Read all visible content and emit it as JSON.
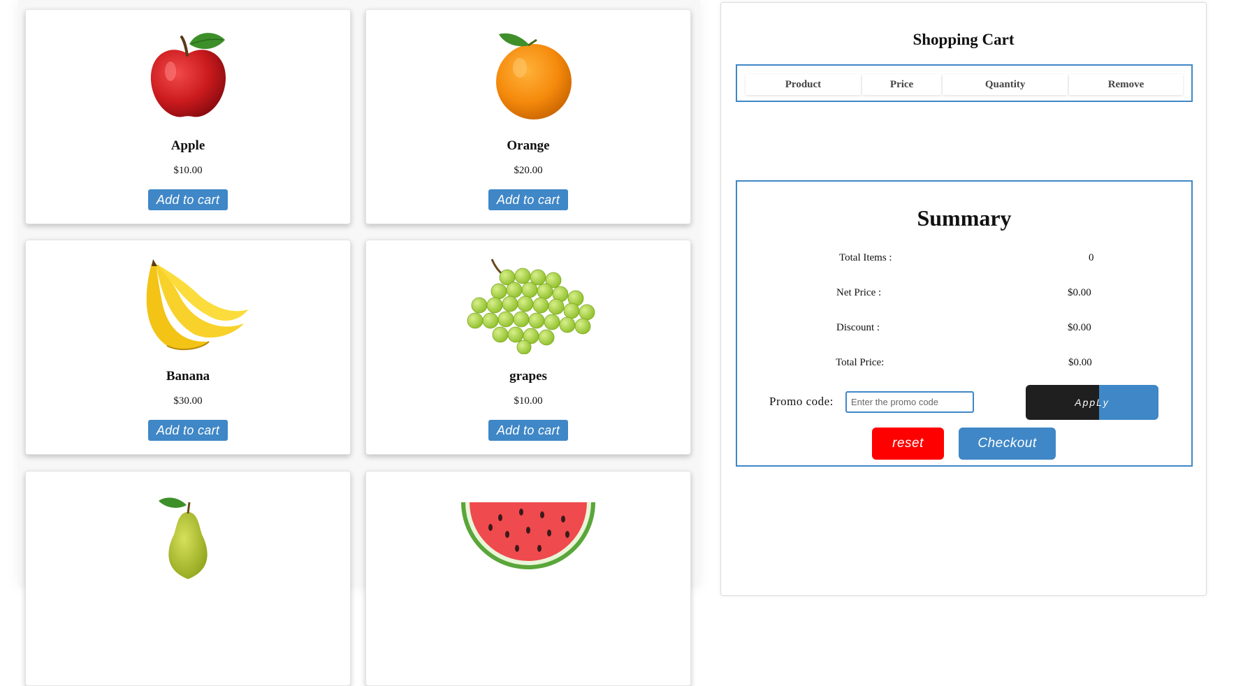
{
  "products": [
    {
      "name": "Apple",
      "price": "$10.00",
      "button": "Add to cart",
      "icon": "apple-icon"
    },
    {
      "name": "Orange",
      "price": "$20.00",
      "button": "Add to cart",
      "icon": "orange-icon"
    },
    {
      "name": "Banana",
      "price": "$30.00",
      "button": "Add to cart",
      "icon": "banana-icon"
    },
    {
      "name": "grapes",
      "price": "$10.00",
      "button": "Add to cart",
      "icon": "grapes-icon"
    },
    {
      "name": "",
      "price": "",
      "button": "",
      "icon": "pear-icon"
    },
    {
      "name": "",
      "price": "",
      "button": "",
      "icon": "watermelon-icon"
    }
  ],
  "cart": {
    "title": "Shopping Cart",
    "columns": [
      "Product",
      "Price",
      "Quantity",
      "Remove"
    ]
  },
  "summary": {
    "title": "Summary",
    "rows": [
      {
        "label": "Total Items :",
        "value": "0"
      },
      {
        "label": "Net Price :",
        "value": "$0.00"
      },
      {
        "label": "Discount :",
        "value": "$0.00"
      },
      {
        "label": "Total Price:",
        "value": "$0.00"
      }
    ],
    "promo_label": "Promo code:",
    "promo_placeholder": "Enter the promo code",
    "promo_value": "",
    "apply_label": "AppLy",
    "reset_label": "reset",
    "checkout_label": "Checkout"
  },
  "colors": {
    "accent": "#3f87c7",
    "reset": "#ff0000",
    "apply_dark": "#1f1f1f"
  }
}
